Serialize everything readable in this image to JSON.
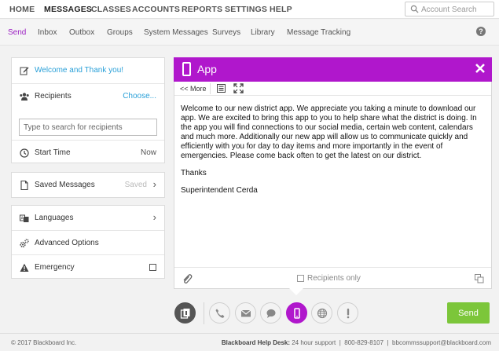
{
  "topnav": {
    "items": [
      {
        "label": "HOME"
      },
      {
        "label": "MESSAGES",
        "active": true
      },
      {
        "label": "CLASSES"
      },
      {
        "label": "ACCOUNTS"
      },
      {
        "label": "REPORTS"
      },
      {
        "label": "SETTINGS"
      },
      {
        "label": "HELP"
      }
    ],
    "search_placeholder": "Account Search"
  },
  "subnav": {
    "items": [
      {
        "label": "Send",
        "active": true
      },
      {
        "label": "Inbox"
      },
      {
        "label": "Outbox"
      },
      {
        "label": "Groups"
      },
      {
        "label": "System Messages"
      },
      {
        "label": "Surveys"
      },
      {
        "label": "Library"
      },
      {
        "label": "Message Tracking"
      }
    ],
    "help_glyph": "?"
  },
  "left": {
    "message_title": "Welcome and Thank you!",
    "recipients_label": "Recipients",
    "choose_label": "Choose...",
    "recipients_placeholder": "Type to search for recipients",
    "start_time_label": "Start Time",
    "start_time_value": "Now",
    "saved_messages_label": "Saved Messages",
    "saved_status": "Saved",
    "languages_label": "Languages",
    "advanced_label": "Advanced Options",
    "emergency_label": "Emergency",
    "chevron_glyph": "›"
  },
  "app_panel": {
    "title": "App",
    "more_label": "<< More",
    "body": [
      "Welcome to our new district app.  We appreciate you taking a minute to download our app.  We are excited to bring this app to you to help share what the district is doing.  In the app you will find connections to our social media, certain web content, calendars and much more.  Additionally our new app will allow us to communicate quickly and efficiently with you for day to day items and more importantly in the event of emergencies.  Please come back often to get the latest on our district.",
      "Thanks",
      "Superintendent Cerda"
    ],
    "recipients_only_label": "Recipients only"
  },
  "channels": [
    {
      "icon": "channel-overview-icon"
    },
    {
      "icon": "phone-icon"
    },
    {
      "icon": "email-icon"
    },
    {
      "icon": "sms-icon"
    },
    {
      "icon": "app-icon",
      "active": true
    },
    {
      "icon": "globe-icon"
    },
    {
      "icon": "alert-icon"
    }
  ],
  "send_label": "Send",
  "footer": {
    "copyright": "© 2017 Blackboard Inc.",
    "helpdesk_label": "Blackboard Help Desk:",
    "helpdesk_hours": "24 hour support",
    "helpdesk_phone": "800-829-8107",
    "helpdesk_email": "bbcommssupport@blackboard.com"
  },
  "colors": {
    "accent": "#b017cc",
    "send": "#7cc63a",
    "link": "#2aa0d8"
  }
}
